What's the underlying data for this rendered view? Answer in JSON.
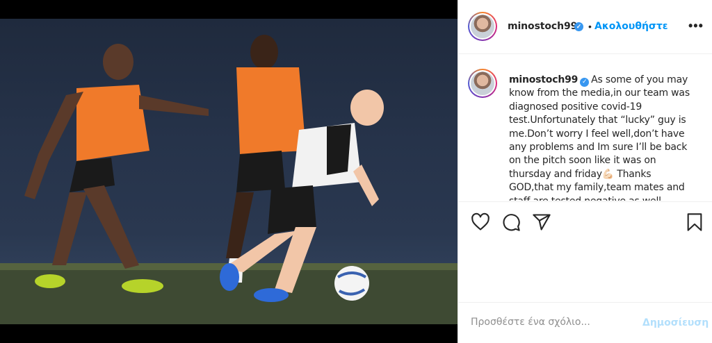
{
  "media": {
    "alt_icon": "training-photo"
  },
  "post": {
    "username": "minostoch99",
    "verified_icon": "verified-badge-icon",
    "separator": "•",
    "follow_label": "Ακολουθήστε",
    "more_label": "•••"
  },
  "caption": {
    "username": "minostoch99",
    "text": "As some of you may know from the media,in our team was diagnosed positive covid-19 test.Unfortunately that “lucky” guy is me.Don’t worry I feel well,don’t have any problems and Im sure I’ll be back on the pitch soon like it was on thursday and friday💪🏻 Thanks GOD,that my family,team mates and staff are tested negative as well"
  },
  "actions": {
    "like_icon": "heart-icon",
    "comment_icon": "comment-icon",
    "share_icon": "share-icon",
    "save_icon": "bookmark-icon"
  },
  "comment": {
    "placeholder": "Προσθέστε ένα σχόλιο...",
    "post_label": "Δημοσίευση"
  },
  "colors": {
    "link": "#0095f6",
    "verified": "#3897f0",
    "post_disabled": "#b2dffc"
  }
}
